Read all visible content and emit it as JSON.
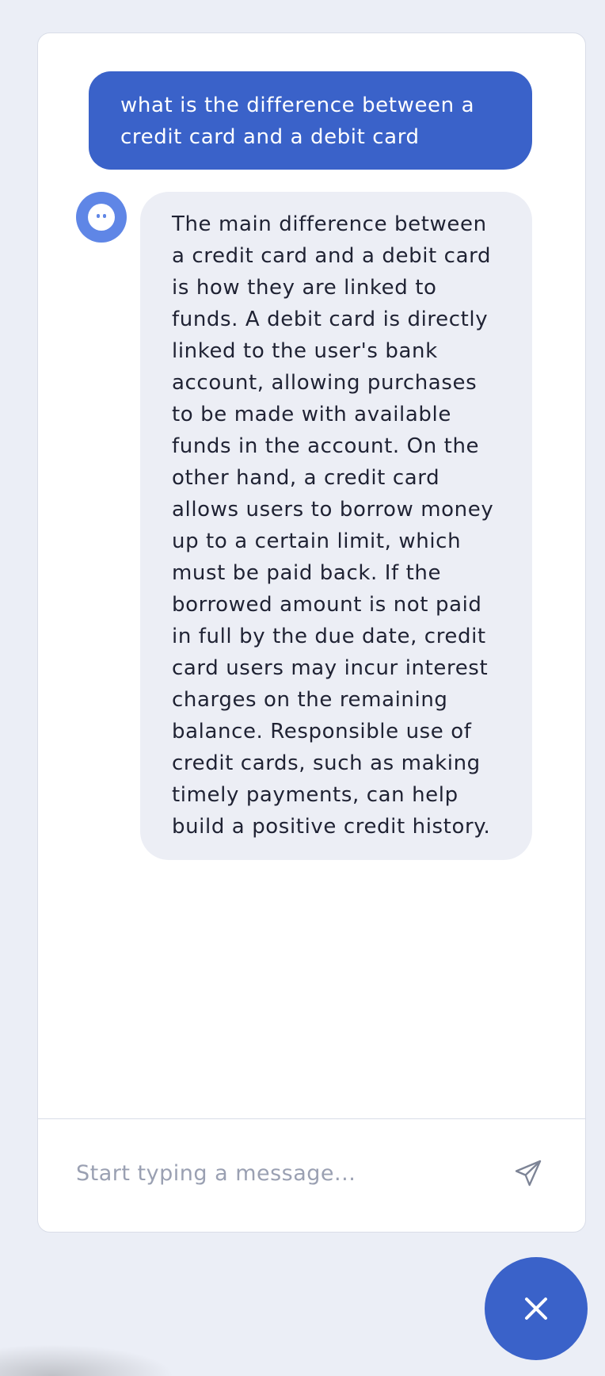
{
  "chat": {
    "messages": [
      {
        "role": "user",
        "text": "what is the difference between a credit card and a debit card"
      },
      {
        "role": "bot",
        "text": "The main difference between a credit card and a debit card is how they are linked to funds. A debit card is directly linked to the user's bank account, allowing purchases to be made with available funds in the account. On the other hand, a credit card allows users to borrow money up to a certain limit, which must be paid back. If the borrowed amount is not paid in full by the due date, credit card users may incur interest charges on the remaining balance. Responsible use of credit cards, such as making timely payments, can help build a positive credit history."
      }
    ]
  },
  "composer": {
    "placeholder": "Start typing a message...",
    "value": "",
    "send_icon": "send-paper-plane-icon"
  },
  "launcher": {
    "icon": "close-icon"
  },
  "colors": {
    "accent": "#3a62c9",
    "avatar": "#5f86e6",
    "page_background": "#ebeef6",
    "bot_bubble": "#eceef5",
    "text": "#1f2233",
    "placeholder": "#9aa0b2"
  }
}
